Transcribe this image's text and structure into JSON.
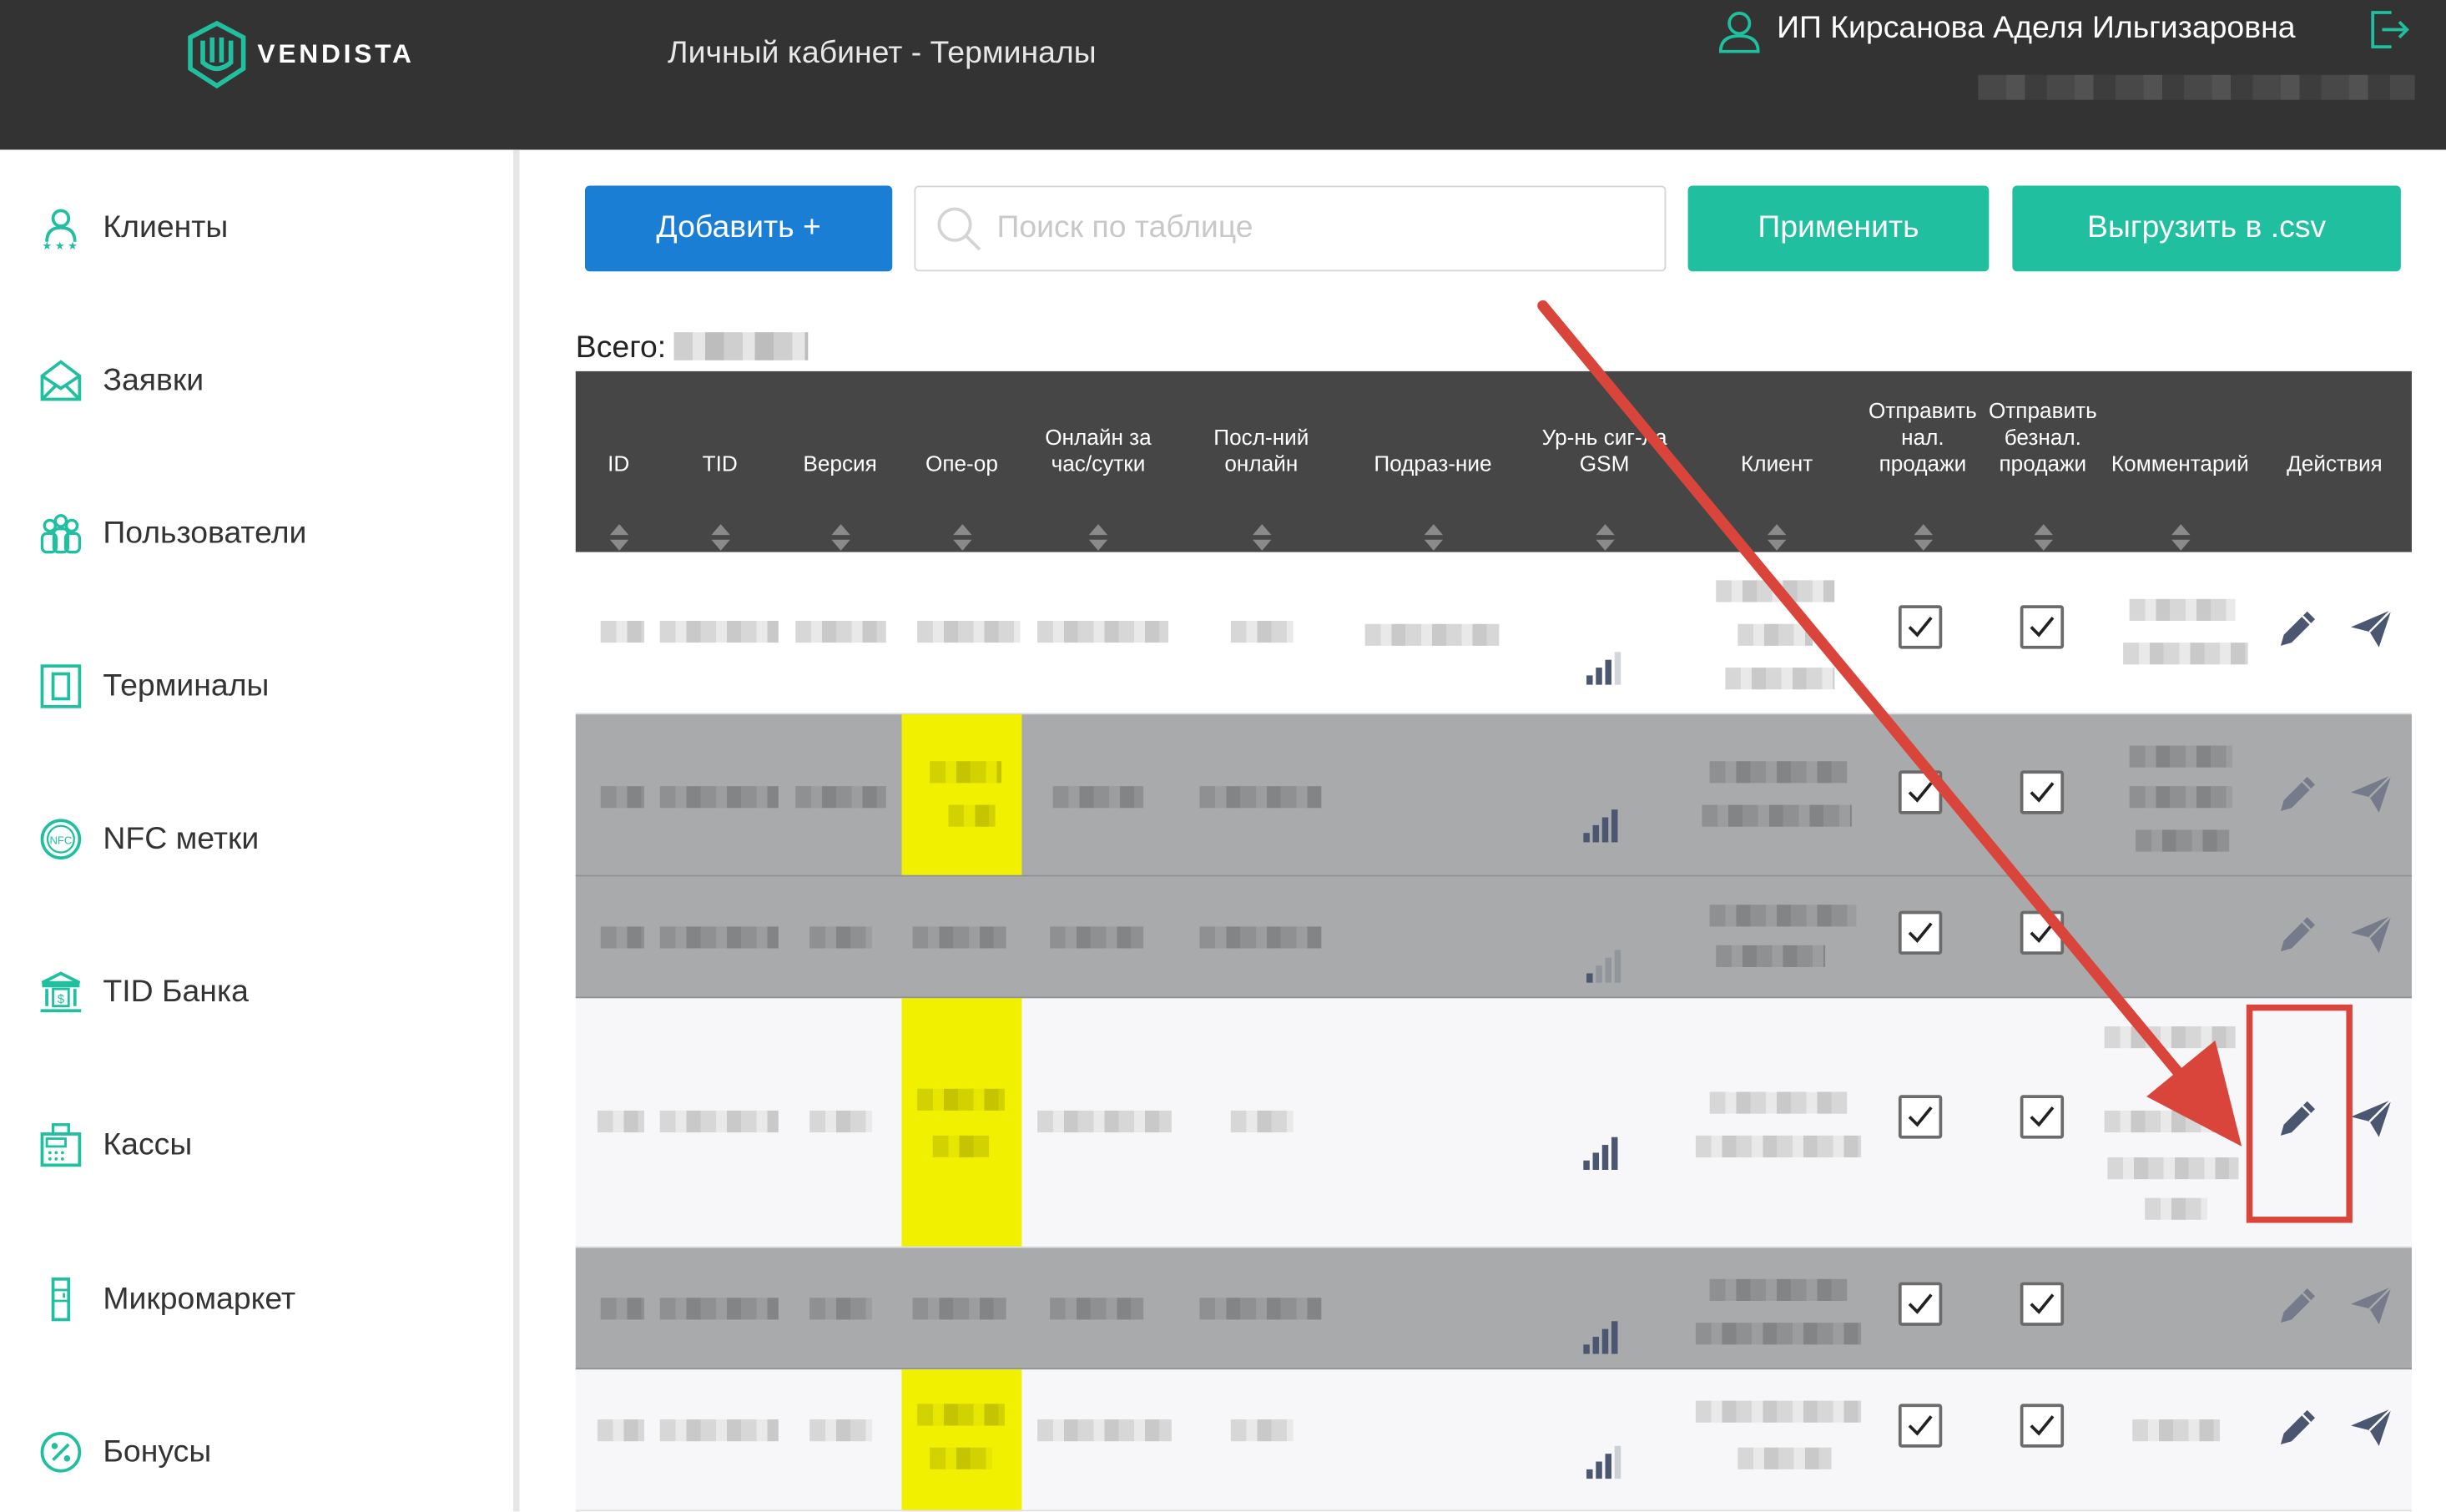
{
  "header": {
    "brand": "VENDISTA",
    "page_title": "Личный кабинет - Терминалы",
    "user_name": "ИП Кирсанова Аделя Ильгизаровна",
    "colors": {
      "bar": "#333333",
      "accent": "#1fbf9f"
    }
  },
  "sidebar": {
    "items": [
      {
        "label": "Клиенты",
        "icon": "clients-icon"
      },
      {
        "label": "Заявки",
        "icon": "envelope-icon"
      },
      {
        "label": "Пользователи",
        "icon": "users-icon"
      },
      {
        "label": "Терминалы",
        "icon": "terminal-icon"
      },
      {
        "label": "NFC метки",
        "icon": "nfc-icon"
      },
      {
        "label": "TID Банка",
        "icon": "bank-icon"
      },
      {
        "label": "Кассы",
        "icon": "cash-register-icon"
      },
      {
        "label": "Микромаркет",
        "icon": "micromarket-icon"
      },
      {
        "label": "Бонусы",
        "icon": "bonus-icon"
      }
    ]
  },
  "toolbar": {
    "add_label": "Добавить +",
    "search_placeholder": "Поиск по таблице",
    "apply_label": "Применить",
    "export_label": "Выгрузить в .csv",
    "colors": {
      "add": "#1a7fd4",
      "apply": "#1fbf9f"
    }
  },
  "summary": {
    "total_label": "Всего:"
  },
  "table": {
    "columns": [
      {
        "key": "id",
        "label": "ID"
      },
      {
        "key": "tid",
        "label": "TID"
      },
      {
        "key": "version",
        "label": "Версия"
      },
      {
        "key": "operator",
        "label": "Опе-ор"
      },
      {
        "key": "online",
        "label": "Онлайн за\nчас/сутки"
      },
      {
        "key": "last_online",
        "label": "Посл-ний\nонлайн"
      },
      {
        "key": "division",
        "label": "Подраз-ние"
      },
      {
        "key": "gsm",
        "label": "Ур-нь сиг-ла\nGSM"
      },
      {
        "key": "client",
        "label": "Клиент"
      },
      {
        "key": "send_cash",
        "label": "Отправить\nнал.\nпродажи"
      },
      {
        "key": "send_cashless",
        "label": "Отправить\nбезнал.\nпродажи"
      },
      {
        "key": "comment",
        "label": "Комментарий"
      },
      {
        "key": "actions",
        "label": "Действия"
      }
    ],
    "rows": [
      {
        "style": "white",
        "operator_highlight": false,
        "gsm_bars": 3,
        "send_cash": true,
        "send_cashless": true
      },
      {
        "style": "gray",
        "operator_highlight": true,
        "gsm_bars": 4,
        "send_cash": true,
        "send_cashless": true
      },
      {
        "style": "gray",
        "operator_highlight": false,
        "gsm_bars": 1,
        "send_cash": true,
        "send_cashless": true
      },
      {
        "style": "light",
        "operator_highlight": true,
        "gsm_bars": 4,
        "send_cash": true,
        "send_cashless": true,
        "annotated_edit": true
      },
      {
        "style": "gray",
        "operator_highlight": false,
        "gsm_bars": 4,
        "send_cash": true,
        "send_cashless": true
      },
      {
        "style": "light",
        "operator_highlight": true,
        "gsm_bars": 2,
        "send_cash": true,
        "send_cashless": true
      }
    ]
  },
  "annotation": {
    "color": "#d9453b"
  }
}
